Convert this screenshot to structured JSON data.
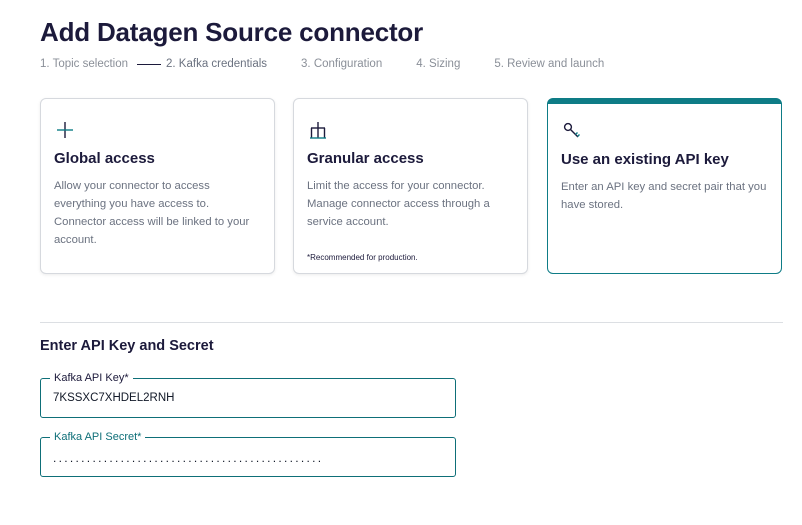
{
  "page": {
    "title": "Add Datagen Source connector"
  },
  "stepper": {
    "steps": [
      {
        "label": "1. Topic selection"
      },
      {
        "label": "2. Kafka credentials"
      },
      {
        "label": "3. Configuration"
      },
      {
        "label": "4. Sizing"
      },
      {
        "label": "5. Review and launch"
      }
    ],
    "active_index": 1
  },
  "access_options": [
    {
      "icon": "globe-icon",
      "title": "Global access",
      "description": "Allow your connector to access everything you have access to. Connector access will be linked to your account.",
      "note": ""
    },
    {
      "icon": "org-tree-icon",
      "title": "Granular access",
      "description": "Limit the access for your connector. Manage connector access through a service account.",
      "note": "*Recommended for production."
    },
    {
      "icon": "key-icon",
      "title": "Use an existing API key",
      "description": "Enter an API key and secret pair that you have stored.",
      "note": "",
      "selected": true
    }
  ],
  "credentials": {
    "title": "Enter API Key and Secret",
    "api_key": {
      "label": "Kafka API Key*",
      "value": "7KSSXC7XHDEL2RNH"
    },
    "api_secret": {
      "label": "Kafka API Secret*",
      "value": "................................................"
    }
  },
  "colors": {
    "accent": "#0e7c86",
    "heading": "#1c1a3b",
    "muted": "#6b7280"
  }
}
